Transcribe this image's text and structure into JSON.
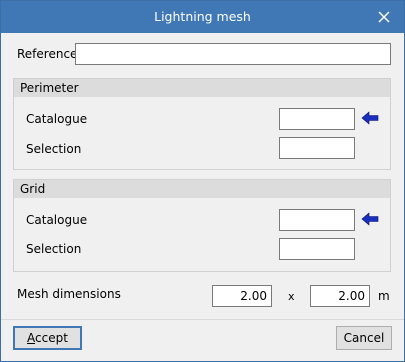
{
  "window": {
    "title": "Lightning mesh"
  },
  "reference": {
    "label": "Reference",
    "value": ""
  },
  "perimeter": {
    "heading": "Perimeter",
    "catalogue_label": "Catalogue",
    "catalogue_value": "",
    "selection_label": "Selection",
    "selection_value": ""
  },
  "grid": {
    "heading": "Grid",
    "catalogue_label": "Catalogue",
    "catalogue_value": "",
    "selection_label": "Selection",
    "selection_value": ""
  },
  "mesh": {
    "label": "Mesh dimensions",
    "width_value": "2.00",
    "separator": "x",
    "height_value": "2.00",
    "unit": "m"
  },
  "buttons": {
    "accept_first": "A",
    "accept_rest": "ccept",
    "cancel": "Cancel"
  },
  "colors": {
    "titlebar": "#3f78b5",
    "arrow": "#1a2fbf"
  },
  "icons": {
    "close": "close-icon",
    "arrow": "arrow-left-icon"
  }
}
